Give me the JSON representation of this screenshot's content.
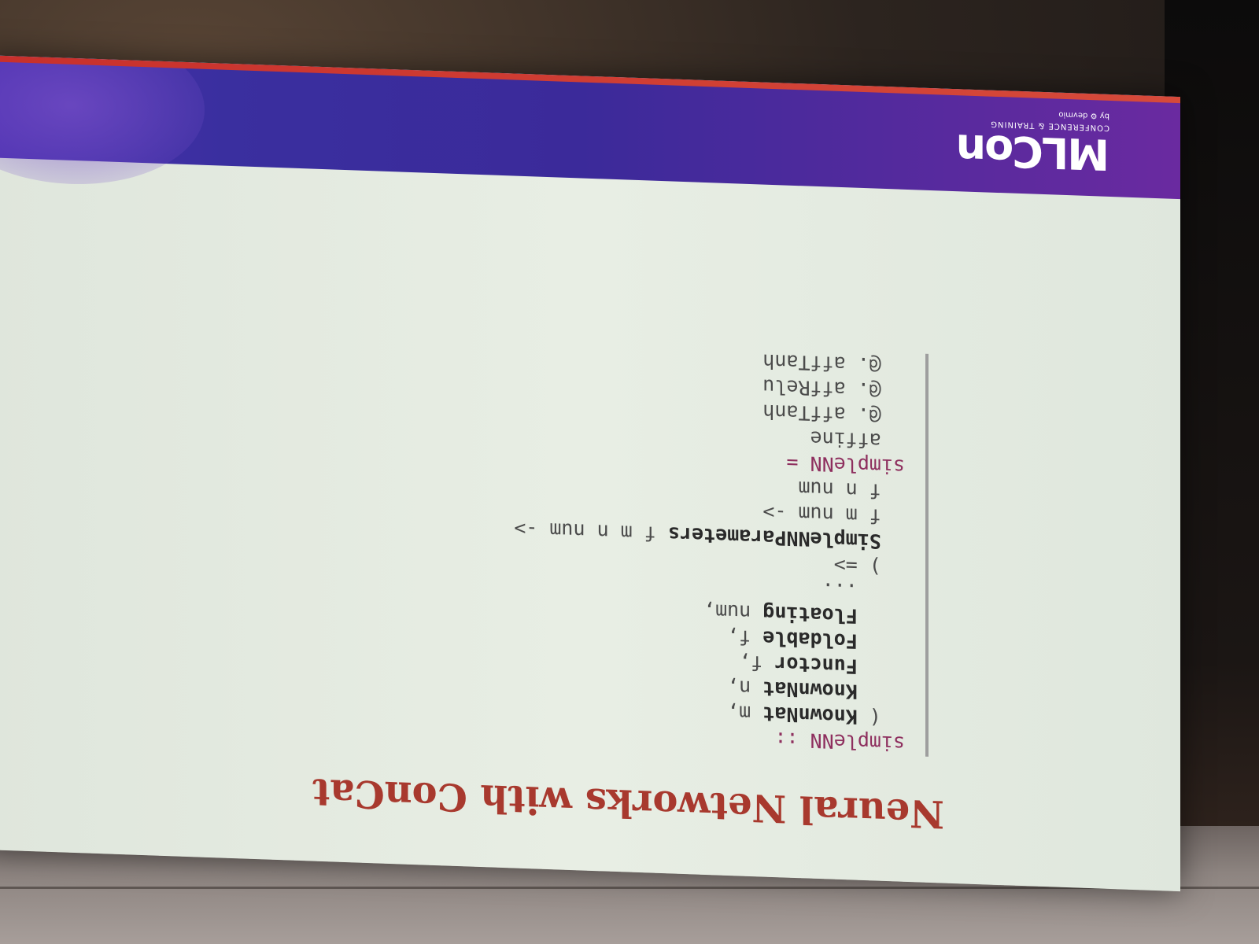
{
  "slide": {
    "title": "Neural Networks with ConCat",
    "code_lines": [
      [
        {
          "t": "simpleNN ::",
          "c": "kw"
        }
      ],
      [
        {
          "t": "  ( ",
          "c": "plain"
        },
        {
          "t": "KnownNat",
          "c": "type"
        },
        {
          "t": " m,",
          "c": "plain"
        }
      ],
      [
        {
          "t": "    ",
          "c": "plain"
        },
        {
          "t": "KnownNat",
          "c": "type"
        },
        {
          "t": " n,",
          "c": "plain"
        }
      ],
      [
        {
          "t": "    ",
          "c": "plain"
        },
        {
          "t": "Functor",
          "c": "type"
        },
        {
          "t": " f,",
          "c": "plain"
        }
      ],
      [
        {
          "t": "    ",
          "c": "plain"
        },
        {
          "t": "Foldable",
          "c": "type"
        },
        {
          "t": " f,",
          "c": "plain"
        }
      ],
      [
        {
          "t": "    ",
          "c": "plain"
        },
        {
          "t": "Floating",
          "c": "type"
        },
        {
          "t": " num,",
          "c": "plain"
        }
      ],
      [
        {
          "t": "    ...",
          "c": "plain"
        }
      ],
      [
        {
          "t": "  ) =>",
          "c": "plain"
        }
      ],
      [
        {
          "t": "  ",
          "c": "plain"
        },
        {
          "t": "SimpleNNParameters",
          "c": "type"
        },
        {
          "t": " f m n num ->",
          "c": "plain"
        }
      ],
      [
        {
          "t": "  f m num ->",
          "c": "plain"
        }
      ],
      [
        {
          "t": "  f n num",
          "c": "plain"
        }
      ],
      [
        {
          "t": "simpleNN =",
          "c": "kw"
        }
      ],
      [
        {
          "t": "  affine",
          "c": "plain"
        }
      ],
      [
        {
          "t": "  @. affTanh",
          "c": "plain"
        }
      ],
      [
        {
          "t": "  @. affRelu",
          "c": "plain"
        }
      ],
      [
        {
          "t": "  @. affTanh",
          "c": "plain"
        }
      ]
    ],
    "footer": {
      "logo_word": "MLCon",
      "logo_sub": "CONFERENCE & TRAINING",
      "logo_by": "by ⚙ devmio"
    }
  },
  "colors": {
    "title": "#a8392e",
    "keyword": "#8e2f5e",
    "footer_purple": "#3b2a9a",
    "footer_accent": "#d64a3a"
  }
}
